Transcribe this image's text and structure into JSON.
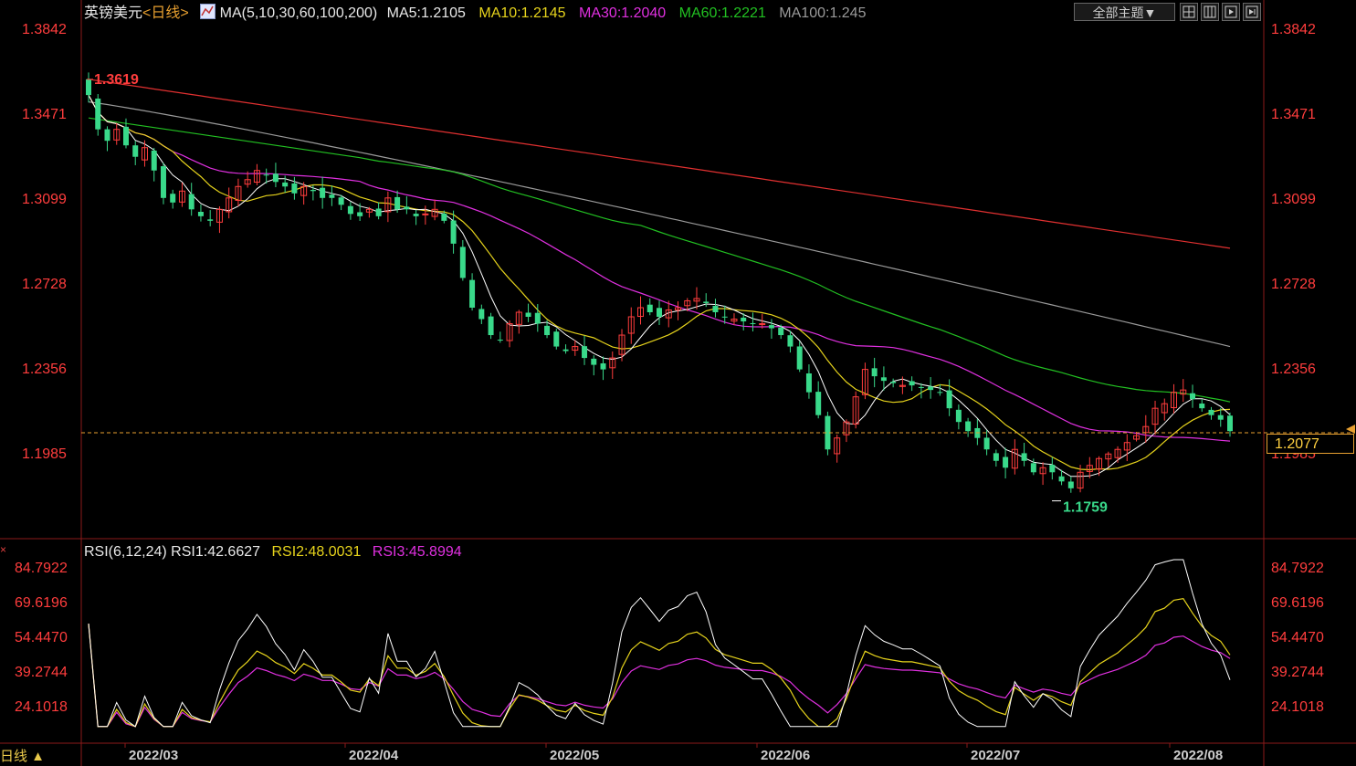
{
  "header": {
    "pair": "英镑美元",
    "period": "<日线>",
    "ma_params": "MA(5,10,30,60,100,200)",
    "ma5": "MA5:1.2105",
    "ma10": "MA10:1.2145",
    "ma30": "MA30:1.2040",
    "ma60": "MA60:1.2221",
    "ma100": "MA100:1.245",
    "theme_button": "全部主题▼"
  },
  "rsi_header": {
    "params": "RSI(6,12,24)",
    "rsi1": "RSI1:42.6627",
    "rsi2": "RSI2:48.0031",
    "rsi3": "RSI3:45.8994"
  },
  "price_axis": [
    "1.3842",
    "1.3471",
    "1.3099",
    "1.2728",
    "1.2356",
    "1.1985"
  ],
  "rsi_axis": [
    "84.7922",
    "69.6196",
    "54.4470",
    "39.2744",
    "24.1018"
  ],
  "x_axis": [
    "2022/03",
    "2022/04",
    "2022/05",
    "2022/06",
    "2022/07",
    "2022/08"
  ],
  "annotations": {
    "high": "1.3619",
    "low": "1.1759"
  },
  "current_price": "1.2077",
  "bottom_tab": "日线 ▲",
  "colors": {
    "up": "#ff3d3d",
    "down": "#39d98a",
    "ma5": "#ffffff",
    "ma10": "#e6d31c",
    "ma30": "#e030e0",
    "ma60": "#22c022",
    "ma100": "#9a9a9a",
    "ma200": "#e03030",
    "axis_text": "#ff3d3d",
    "grid": "#8b1a1a"
  },
  "chart_data": [
    {
      "type": "candlestick",
      "title": "英镑美元 日线",
      "ylim": [
        1.17,
        1.39
      ],
      "x_start": "2022-02-24",
      "x_end": "2022-08-08",
      "y_ticks": [
        1.3842,
        1.3471,
        1.3099,
        1.2728,
        1.2356,
        1.1985
      ],
      "annotations": [
        {
          "label": "1.3619",
          "value": 1.3619
        },
        {
          "label": "1.1759",
          "value": 1.1759
        }
      ],
      "current_price": 1.2077,
      "close_series": [
        1.355,
        1.34,
        1.335,
        1.34,
        1.333,
        1.328,
        1.332,
        1.322,
        1.31,
        1.308,
        1.313,
        1.305,
        1.302,
        1.3,
        1.305,
        1.31,
        1.315,
        1.318,
        1.322,
        1.32,
        1.317,
        1.315,
        1.312,
        1.315,
        1.313,
        1.31,
        1.31,
        1.307,
        1.303,
        1.302,
        1.305,
        1.302,
        1.31,
        1.305,
        1.305,
        1.302,
        1.303,
        1.305,
        1.3,
        1.29,
        1.275,
        1.262,
        1.257,
        1.25,
        1.248,
        1.255,
        1.26,
        1.258,
        1.255,
        1.25,
        1.245,
        1.243,
        1.245,
        1.24,
        1.237,
        1.235,
        1.24,
        1.25,
        1.258,
        1.262,
        1.26,
        1.258,
        1.261,
        1.262,
        1.265,
        1.266,
        1.264,
        1.26,
        1.258,
        1.257,
        1.256,
        1.255,
        1.255,
        1.253,
        1.25,
        1.245,
        1.235,
        1.225,
        1.215,
        1.2,
        1.205,
        1.212,
        1.223,
        1.235,
        1.232,
        1.23,
        1.229,
        1.228,
        1.228,
        1.227,
        1.226,
        1.225,
        1.218,
        1.212,
        1.208,
        1.205,
        1.2,
        1.195,
        1.192,
        1.2,
        1.195,
        1.19,
        1.192,
        1.19,
        1.186,
        1.183,
        1.19,
        1.193,
        1.196,
        1.198,
        1.2,
        1.203,
        1.206,
        1.21,
        1.218,
        1.22,
        1.225,
        1.226,
        1.222,
        1.218,
        1.215,
        1.213,
        1.208
      ],
      "ma_lines": [
        {
          "name": "MA5",
          "last": 1.2105
        },
        {
          "name": "MA10",
          "last": 1.2145
        },
        {
          "name": "MA30",
          "last": 1.204
        },
        {
          "name": "MA60",
          "last": 1.2221
        },
        {
          "name": "MA100",
          "last": 1.245
        },
        {
          "name": "MA200",
          "start": 1.3619,
          "end": 1.288
        }
      ]
    },
    {
      "type": "line",
      "title": "RSI(6,12,24)",
      "ylim": [
        10,
        90
      ],
      "y_ticks": [
        84.7922,
        69.6196,
        54.447,
        39.2744,
        24.1018
      ],
      "series": [
        {
          "name": "RSI1",
          "last": 42.6627
        },
        {
          "name": "RSI2",
          "last": 48.0031
        },
        {
          "name": "RSI3",
          "last": 45.8994
        }
      ]
    }
  ]
}
